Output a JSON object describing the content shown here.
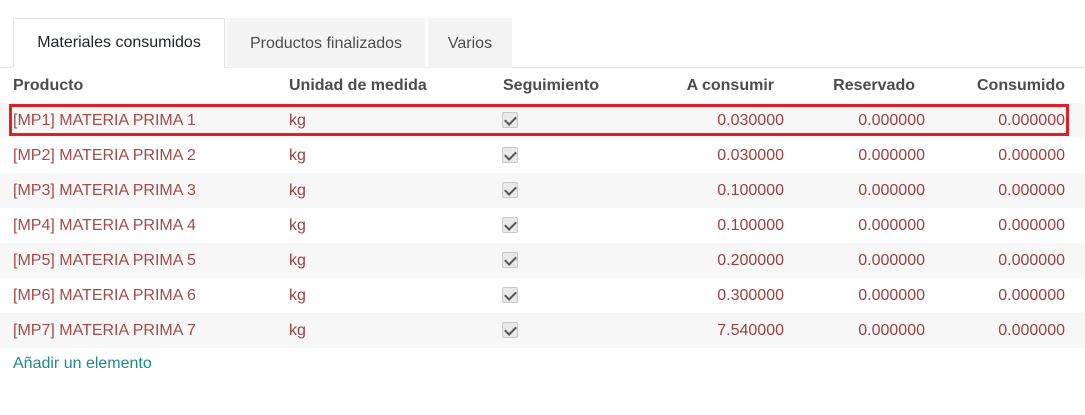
{
  "tabs": [
    {
      "label": "Materiales consumidos",
      "active": true
    },
    {
      "label": "Productos finalizados",
      "active": false
    },
    {
      "label": "Varios",
      "active": false
    }
  ],
  "columns": {
    "product": "Producto",
    "uom": "Unidad de medida",
    "tracking": "Seguimiento",
    "to_consume": "A consumir",
    "reserved": "Reservado",
    "consumed": "Consumido"
  },
  "rows": [
    {
      "product": "[MP1] MATERIA PRIMA 1",
      "uom": "kg",
      "tracked": true,
      "to_consume": "0.030000",
      "reserved": "0.000000",
      "consumed": "0.000000"
    },
    {
      "product": "[MP2] MATERIA PRIMA 2",
      "uom": "kg",
      "tracked": true,
      "to_consume": "0.030000",
      "reserved": "0.000000",
      "consumed": "0.000000"
    },
    {
      "product": "[MP3] MATERIA PRIMA 3",
      "uom": "kg",
      "tracked": true,
      "to_consume": "0.100000",
      "reserved": "0.000000",
      "consumed": "0.000000"
    },
    {
      "product": "[MP4] MATERIA PRIMA 4",
      "uom": "kg",
      "tracked": true,
      "to_consume": "0.100000",
      "reserved": "0.000000",
      "consumed": "0.000000"
    },
    {
      "product": "[MP5] MATERIA PRIMA 5",
      "uom": "kg",
      "tracked": true,
      "to_consume": "0.200000",
      "reserved": "0.000000",
      "consumed": "0.000000"
    },
    {
      "product": "[MP6] MATERIA PRIMA 6",
      "uom": "kg",
      "tracked": true,
      "to_consume": "0.300000",
      "reserved": "0.000000",
      "consumed": "0.000000"
    },
    {
      "product": "[MP7] MATERIA PRIMA 7",
      "uom": "kg",
      "tracked": true,
      "to_consume": "7.540000",
      "reserved": "0.000000",
      "consumed": "0.000000"
    }
  ],
  "add_line_label": "Añadir un elemento",
  "colors": {
    "link": "#a34a4a",
    "add_link": "#1d8a8a",
    "highlight": "#e01e25"
  }
}
